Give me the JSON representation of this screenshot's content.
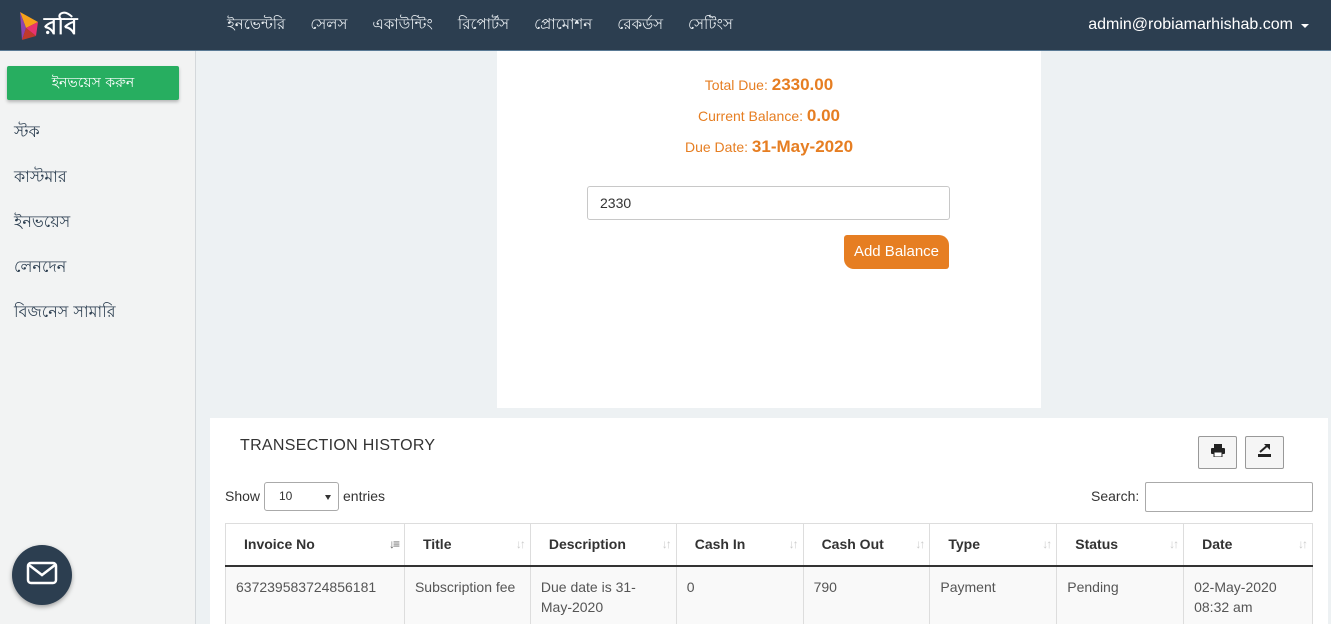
{
  "brand": {
    "name": "রবি"
  },
  "nav": {
    "items": [
      "ইনভেন্টরি",
      "সেলস",
      "একাউন্টিং",
      "রিপোর্টস",
      "প্রোমোশন",
      "রেকর্ডস",
      "সেটিংস"
    ],
    "user": "admin@robiamarhishab.com"
  },
  "sidebar": {
    "invoice_button": "ইনভয়েস করুন",
    "items": [
      "স্টক",
      "কাস্টমার",
      "ইনভয়েস",
      "লেনদেন",
      "বিজনেস সামারি"
    ]
  },
  "balance": {
    "total_due_label": "Total Due:",
    "total_due": "2330.00",
    "current_balance_label": "Current Balance:",
    "current_balance": "0.00",
    "due_date_label": "Due Date:",
    "due_date": "31-May-2020",
    "amount_value": "2330",
    "add_button": "Add Balance"
  },
  "history": {
    "title": "TRANSECTION HISTORY",
    "show_label": "Show",
    "page_size": "10",
    "entries_label": "entries",
    "search_label": "Search:",
    "columns": [
      "Invoice No",
      "Title",
      "Description",
      "Cash In",
      "Cash Out",
      "Type",
      "Status",
      "Date"
    ],
    "rows": [
      {
        "invoice_no": "637239583724856181",
        "title": "Subscription fee",
        "description": "Due date is 31-May-2020",
        "cash_in": "0",
        "cash_out": "790",
        "type": "Payment",
        "status": "Pending",
        "date": "02-May-2020 08:32 am"
      }
    ]
  },
  "colors": {
    "navbar": "#2c3e50",
    "accent_green": "#27ae60",
    "accent_orange": "#e67e22"
  }
}
